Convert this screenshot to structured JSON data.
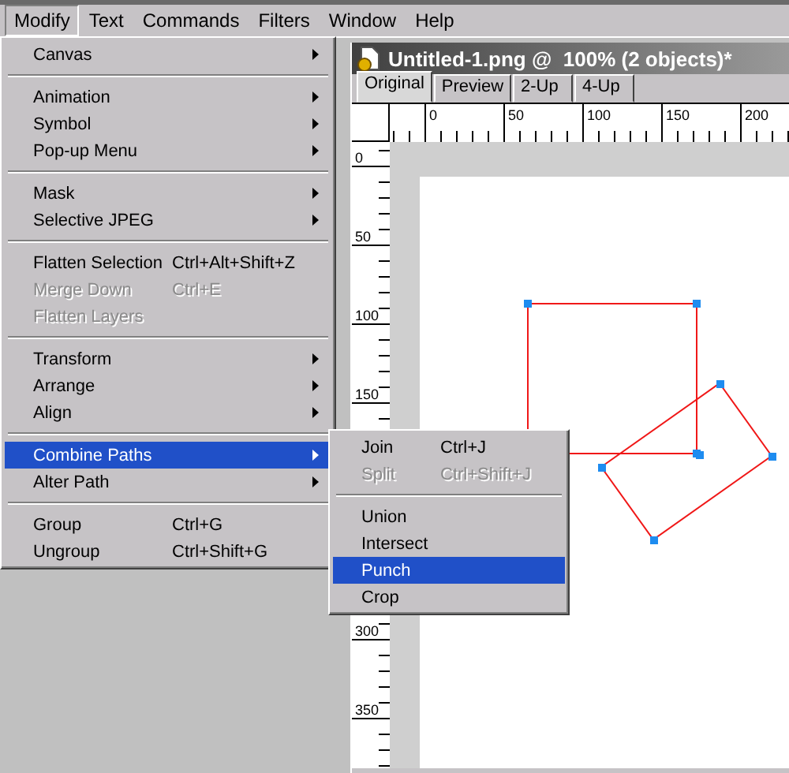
{
  "menu_bar": [
    {
      "label": "Modify",
      "selected": true
    },
    {
      "label": "Text",
      "selected": false
    },
    {
      "label": "Commands",
      "selected": false
    },
    {
      "label": "Filters",
      "selected": false
    },
    {
      "label": "Window",
      "selected": false
    },
    {
      "label": "Help",
      "selected": false
    }
  ],
  "modify_menu": [
    {
      "kind": "item",
      "label": "Canvas",
      "has_submenu": true,
      "disabled": false,
      "selected": false
    },
    {
      "kind": "separator"
    },
    {
      "kind": "item",
      "label": "Animation",
      "has_submenu": true,
      "disabled": false,
      "selected": false
    },
    {
      "kind": "item",
      "label": "Symbol",
      "has_submenu": true,
      "disabled": false,
      "selected": false
    },
    {
      "kind": "item",
      "label": "Pop-up Menu",
      "has_submenu": true,
      "disabled": false,
      "selected": false
    },
    {
      "kind": "separator"
    },
    {
      "kind": "item",
      "label": "Mask",
      "has_submenu": true,
      "disabled": false,
      "selected": false
    },
    {
      "kind": "item",
      "label": "Selective JPEG",
      "has_submenu": true,
      "disabled": false,
      "selected": false
    },
    {
      "kind": "separator"
    },
    {
      "kind": "item",
      "label": "Flatten Selection",
      "shortcut": "Ctrl+Alt+Shift+Z",
      "has_submenu": false,
      "disabled": false,
      "selected": false
    },
    {
      "kind": "item",
      "label": "Merge Down",
      "shortcut": "Ctrl+E",
      "has_submenu": false,
      "disabled": true,
      "selected": false
    },
    {
      "kind": "item",
      "label": "Flatten Layers",
      "has_submenu": false,
      "disabled": true,
      "selected": false
    },
    {
      "kind": "separator"
    },
    {
      "kind": "item",
      "label": "Transform",
      "has_submenu": true,
      "disabled": false,
      "selected": false
    },
    {
      "kind": "item",
      "label": "Arrange",
      "has_submenu": true,
      "disabled": false,
      "selected": false
    },
    {
      "kind": "item",
      "label": "Align",
      "has_submenu": true,
      "disabled": false,
      "selected": false
    },
    {
      "kind": "separator"
    },
    {
      "kind": "item",
      "label": "Combine Paths",
      "has_submenu": true,
      "disabled": false,
      "selected": true
    },
    {
      "kind": "item",
      "label": "Alter Path",
      "has_submenu": true,
      "disabled": false,
      "selected": false
    },
    {
      "kind": "separator"
    },
    {
      "kind": "item",
      "label": "Group",
      "shortcut": "Ctrl+G",
      "has_submenu": false,
      "disabled": false,
      "selected": false
    },
    {
      "kind": "item",
      "label": "Ungroup",
      "shortcut": "Ctrl+Shift+G",
      "has_submenu": false,
      "disabled": false,
      "selected": false
    }
  ],
  "combine_paths_menu": [
    {
      "kind": "item",
      "label": "Join",
      "shortcut": "Ctrl+J",
      "disabled": false,
      "selected": false
    },
    {
      "kind": "item",
      "label": "Split",
      "shortcut": "Ctrl+Shift+J",
      "disabled": true,
      "selected": false
    },
    {
      "kind": "separator"
    },
    {
      "kind": "item",
      "label": "Union",
      "disabled": false,
      "selected": false
    },
    {
      "kind": "item",
      "label": "Intersect",
      "disabled": false,
      "selected": false
    },
    {
      "kind": "item",
      "label": "Punch",
      "disabled": false,
      "selected": true
    },
    {
      "kind": "item",
      "label": "Crop",
      "disabled": false,
      "selected": false
    }
  ],
  "document": {
    "title": "Untitled-1.png @  100% (2 objects)*",
    "tabs": [
      {
        "label": "Original",
        "selected": true
      },
      {
        "label": "Preview",
        "selected": false
      },
      {
        "label": "2-Up",
        "selected": false
      },
      {
        "label": "4-Up",
        "selected": false
      }
    ],
    "top_ruler": [
      "0",
      "50",
      "100",
      "150",
      "200"
    ],
    "left_ruler": [
      "0",
      "50",
      "100",
      "150",
      "300",
      "350"
    ]
  }
}
